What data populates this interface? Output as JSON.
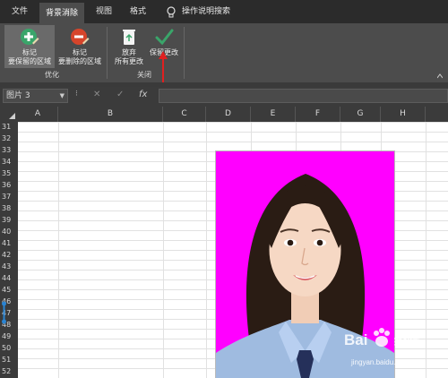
{
  "tabs": [
    {
      "label": "文件",
      "active": false
    },
    {
      "label": "背景消除",
      "active": true
    },
    {
      "label": "视图",
      "active": false
    },
    {
      "label": "格式",
      "active": false
    }
  ],
  "tell_me": "操作说明搜索",
  "ribbon": {
    "mark_keep": {
      "line1": "标记",
      "line2": "要保留的区域"
    },
    "mark_remove": {
      "line1": "标记",
      "line2": "要删除的区域"
    },
    "discard": {
      "line1": "放弃",
      "line2": "所有更改"
    },
    "keep_changes": {
      "line1": "保留更改"
    },
    "group_refine": "优化",
    "group_close": "关闭"
  },
  "formula_bar": {
    "name_box": "图片 3",
    "fx": "fx",
    "formula": ""
  },
  "columns": [
    "A",
    "B",
    "C",
    "D",
    "E",
    "F",
    "G",
    "H"
  ],
  "rows": [
    "31",
    "32",
    "33",
    "34",
    "35",
    "36",
    "37",
    "38",
    "39",
    "40",
    "41",
    "42",
    "43",
    "44",
    "45",
    "46",
    "47",
    "48",
    "49",
    "50",
    "51",
    "52"
  ],
  "photo": {
    "background_color": "#ff00ff"
  },
  "watermark": {
    "brand": "Bai",
    "brand2": "经验",
    "url": "jingyan.baidu.com"
  },
  "colors": {
    "tab_bar": "#2b2b2b",
    "ribbon": "#4c4c4c",
    "keep_green": "#3aa56a",
    "remove_red": "#d6452b",
    "arrow_red": "#e02020"
  }
}
